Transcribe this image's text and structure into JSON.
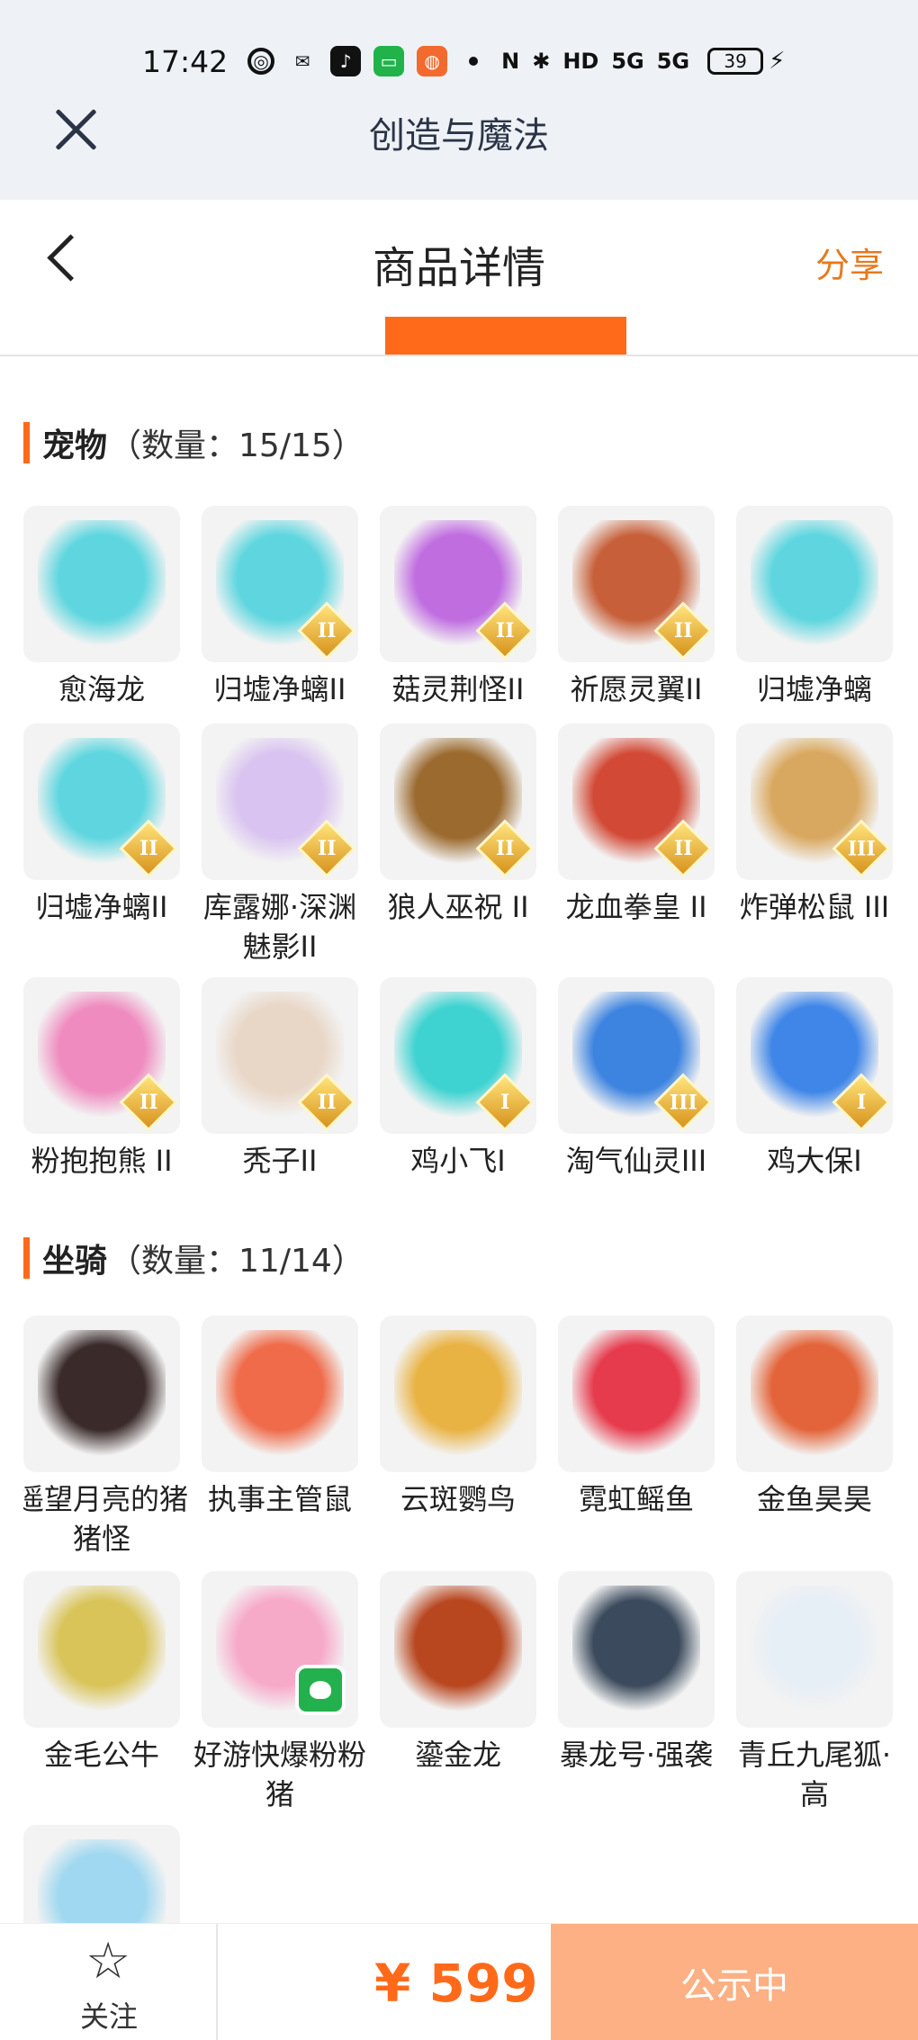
{
  "status_bar": {
    "time": "17:42",
    "net1": "5G",
    "net2": "5G",
    "battery": "39"
  },
  "webview": {
    "title": "创造与魔法"
  },
  "header": {
    "title": "商品详情",
    "share_label": "分享"
  },
  "sections": [
    {
      "name": "宠物",
      "count": "（数量：15/15）",
      "items": [
        {
          "label": "愈海龙",
          "tier": "",
          "color": "#5fd6df"
        },
        {
          "label": "归墟净螭II",
          "tier": "II",
          "color": "#5fd6df"
        },
        {
          "label": "菇灵荆怪II",
          "tier": "II",
          "color": "#c06de0"
        },
        {
          "label": "祈愿灵翼II",
          "tier": "II",
          "color": "#c7603a"
        },
        {
          "label": "归墟净螭",
          "tier": "",
          "color": "#5fd6df"
        },
        {
          "label": "归墟净螭II",
          "tier": "II",
          "color": "#5fd6df"
        },
        {
          "label": "库露娜·深渊魅影II",
          "tier": "II",
          "color": "#d9c3f0"
        },
        {
          "label": "狼人巫祝 II",
          "tier": "II",
          "color": "#9b6a2f"
        },
        {
          "label": "龙血拳皇 II",
          "tier": "II",
          "color": "#d24a36"
        },
        {
          "label": "炸弹松鼠 III",
          "tier": "III",
          "color": "#d9a860"
        },
        {
          "label": "粉抱抱熊 II",
          "tier": "II",
          "color": "#ef8bbf"
        },
        {
          "label": "秃子II",
          "tier": "II",
          "color": "#e8d6c6"
        },
        {
          "label": "鸡小飞I",
          "tier": "I",
          "color": "#3ed3d1"
        },
        {
          "label": "淘气仙灵III",
          "tier": "III",
          "color": "#3d84e0"
        },
        {
          "label": "鸡大保I",
          "tier": "I",
          "color": "#3f86e8"
        }
      ]
    },
    {
      "name": "坐骑",
      "count": "（数量：11/14）",
      "items": [
        {
          "label": "遥望月亮的猪猪怪",
          "tier": "",
          "color": "#3a2a2a"
        },
        {
          "label": "执事主管鼠",
          "tier": "",
          "color": "#ef6b4a"
        },
        {
          "label": "云斑鹦鸟",
          "tier": "",
          "color": "#e9b344"
        },
        {
          "label": "霓虹鳐鱼",
          "tier": "",
          "color": "#e63b4c"
        },
        {
          "label": "金鱼昊昊",
          "tier": "",
          "color": "#e3643a"
        },
        {
          "label": "金毛公牛",
          "tier": "",
          "color": "#d9c45a"
        },
        {
          "label": "好游快爆粉粉猪",
          "tier": "",
          "color": "#f7a9c8",
          "app_badge": true
        },
        {
          "label": "鎏金龙",
          "tier": "",
          "color": "#b8461f"
        },
        {
          "label": "暴龙号·强袭",
          "tier": "",
          "color": "#3b4a5c"
        },
        {
          "label": "青丘九尾狐·高",
          "tier": "",
          "color": "#e6eef6"
        },
        {
          "label": "",
          "tier": "",
          "color": "#9fd8f0"
        }
      ]
    }
  ],
  "bottom_bar": {
    "follow_label": "关注",
    "price": "¥ 599",
    "cta_label": "公示中"
  }
}
